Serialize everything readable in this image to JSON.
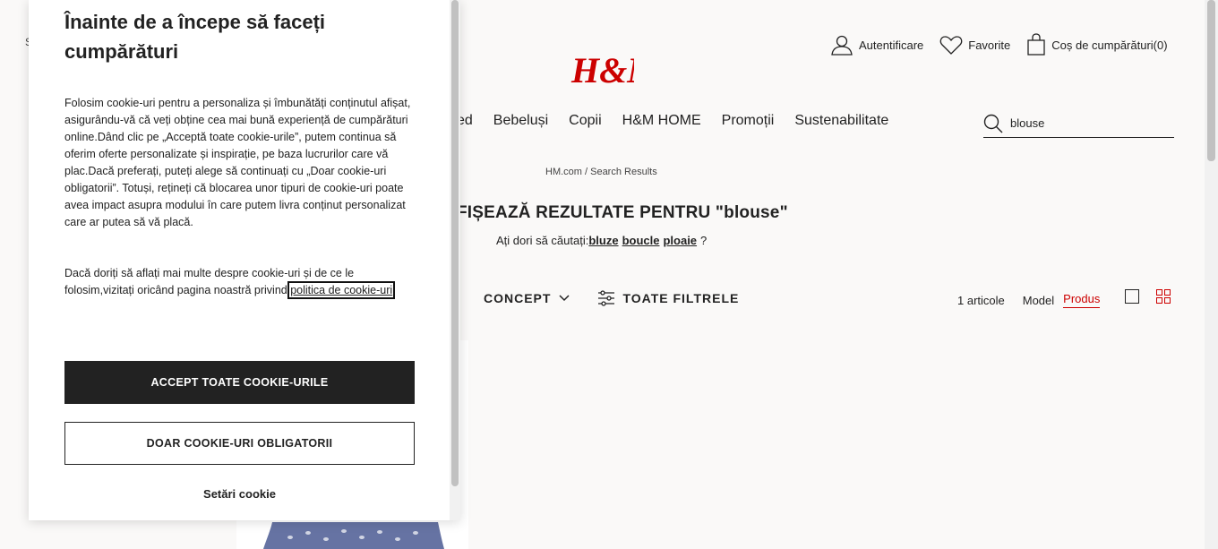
{
  "header": {
    "left_partial": "S",
    "brand": "H&M",
    "links": {
      "login": "Autentificare",
      "favorites": "Favorite",
      "cart": "Coș de cumpărături(0)"
    },
    "nav": [
      "ed",
      "Bebeluși",
      "Copii",
      "H&M HOME",
      "Promoții",
      "Sustenabilitate"
    ],
    "search_value": "blouse"
  },
  "main": {
    "breadcrumb": "HM.com / Search Results",
    "results_title": "FIȘEAZĂ REZULTATE PENTRU \"blouse\"",
    "suggest_prefix": "Ați dori să căutați:",
    "suggestions": [
      "bluze",
      "boucle",
      "ploaie"
    ],
    "suggest_suffix": "?",
    "filters": {
      "concept": "CONCEPT",
      "all_filters": "TOATE FILTRELE"
    },
    "count": "1 articole",
    "view_model": "Model",
    "view_product": "Produs"
  },
  "cookie_modal": {
    "title": "Înainte de a începe să faceți cumpărături",
    "paragraph1": "Folosim cookie-uri pentru a personaliza și îmbunătăți conținutul afișat, asigurându-vă că veți obține cea mai bună experiență de cumpărături online.Dând clic pe „Acceptă toate cookie-urile”, putem continua să oferim oferte personalizate și inspirație, pe baza lucrurilor care vă plac.Dacă preferați, puteți alege să continuați cu „Doar cookie-uri obligatorii”. Totuși, rețineți că blocarea unor tipuri de cookie-uri poate avea impact asupra modului în care putem livra conținut personalizat care ar putea să vă placă.",
    "paragraph2_text": "Dacă doriți să aflați mai multe despre cookie-uri și de ce le folosim,vizitați oricând pagina noastră privind ",
    "paragraph2_link": "politica de cookie-uri",
    "accept_all": "ACCEPT TOATE COOKIE-URILE",
    "required_only": "DOAR COOKIE-URI OBLIGATORII",
    "settings": "Setări cookie"
  },
  "colors": {
    "brand_red": "#cc0000",
    "dark": "#222222",
    "page_bg": "#faf9f8"
  }
}
